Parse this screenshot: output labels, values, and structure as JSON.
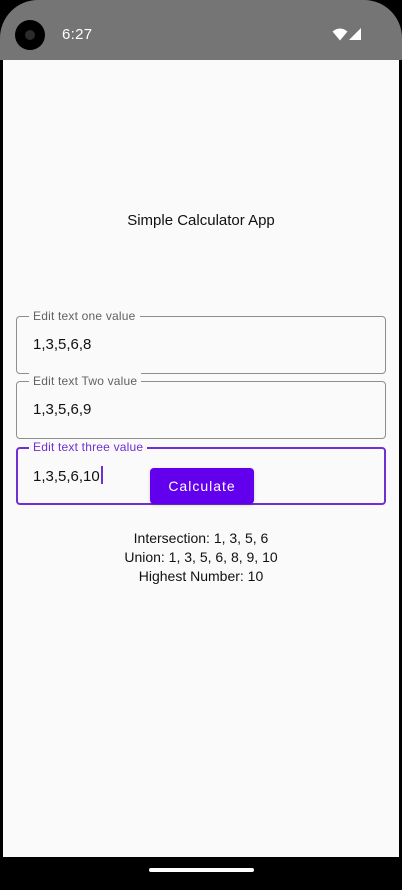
{
  "status_bar": {
    "time": "6:27",
    "icons": [
      "wifi-icon",
      "signal-icon",
      "camera-icon"
    ]
  },
  "app": {
    "title": "Simple Calculator App",
    "fields": [
      {
        "label": "Edit text one value",
        "value": "1,3,5,6,8"
      },
      {
        "label": "Edit text Two value",
        "value": "1,3,5,6,9"
      },
      {
        "label": "Edit text three value",
        "value": "1,3,5,6,10",
        "focused": true
      }
    ],
    "button": {
      "label": "Calculate"
    },
    "results": {
      "intersection": "Intersection: 1, 3, 5, 6",
      "union": "Union: 1, 3, 5, 6, 8, 9, 10",
      "highest": "Highest Number: 10"
    }
  },
  "colors": {
    "status_bar": "#757575",
    "accent": "#6200ee",
    "focused_outline": "#6f2fd4",
    "background": "#fafafa"
  }
}
